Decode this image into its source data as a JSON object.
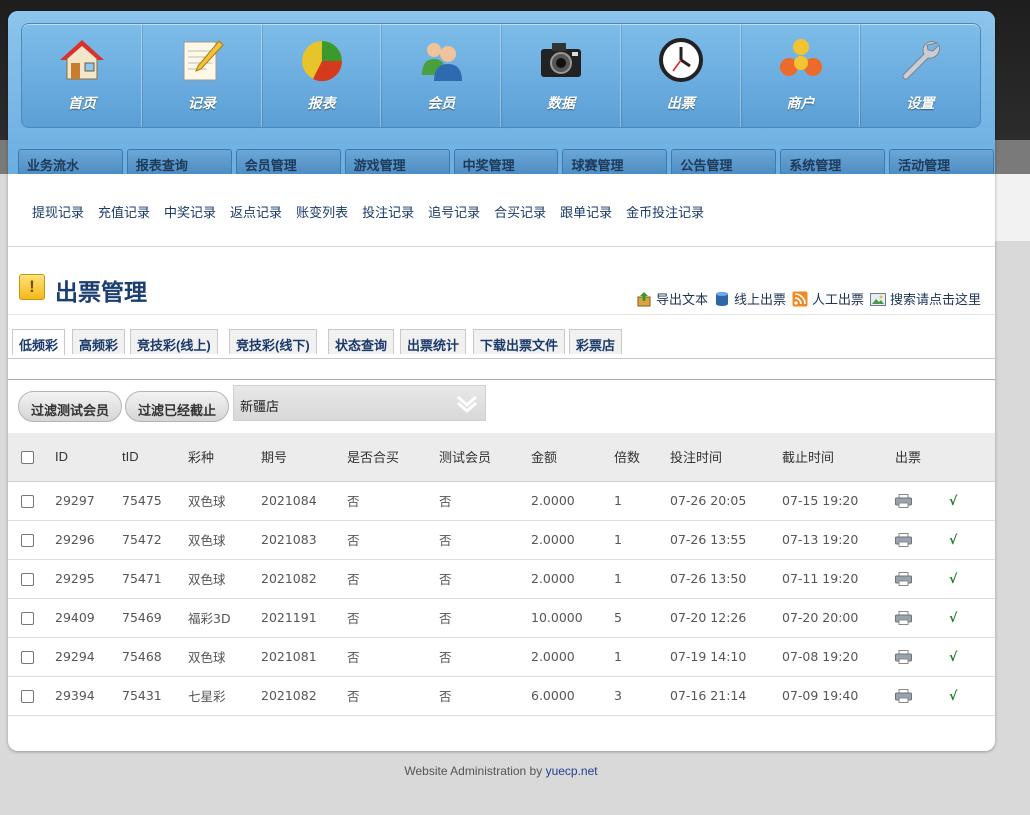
{
  "main_nav": [
    {
      "label": "首页",
      "icon": "home-icon"
    },
    {
      "label": "记录",
      "icon": "notepad-icon"
    },
    {
      "label": "报表",
      "icon": "pie-chart-icon"
    },
    {
      "label": "会员",
      "icon": "users-icon"
    },
    {
      "label": "数据",
      "icon": "camera-icon"
    },
    {
      "label": "出票",
      "icon": "clock-icon"
    },
    {
      "label": "商户",
      "icon": "merchant-icon"
    },
    {
      "label": "设置",
      "icon": "wrench-icon"
    }
  ],
  "sub_tabs": [
    "业务流水",
    "报表查询",
    "会员管理",
    "游戏管理",
    "中奖管理",
    "球赛管理",
    "公告管理",
    "系统管理",
    "活动管理"
  ],
  "sub_links": [
    "提现记录",
    "充值记录",
    "中奖记录",
    "返点记录",
    "账变列表",
    "投注记录",
    "追号记录",
    "合买记录",
    "跟单记录",
    "金币投注记录"
  ],
  "page": {
    "title": "出票管理",
    "title_icon": "!"
  },
  "actions": [
    {
      "label": "导出文本",
      "icon": "export-icon"
    },
    {
      "label": "线上出票",
      "icon": "database-icon"
    },
    {
      "label": "人工出票",
      "icon": "rss-icon"
    },
    {
      "label": "搜索请点击这里",
      "icon": "search-image-icon"
    }
  ],
  "lottery_tabs": [
    "低频彩",
    "高频彩",
    "竞技彩(线上)",
    "竞技彩(线下)",
    "状态查询",
    "出票统计",
    "下载出票文件",
    "彩票店"
  ],
  "filters": {
    "btn_test": "过滤测试会员",
    "btn_expired": "过滤已经截止",
    "store_selected": "新疆店"
  },
  "table": {
    "headers": [
      "ID",
      "tID",
      "彩种",
      "期号",
      "是否合买",
      "测试会员",
      "金额",
      "倍数",
      "投注时间",
      "截止时间",
      "出票"
    ],
    "rows": [
      {
        "id": "29297",
        "tid": "75475",
        "type": "双色球",
        "issue": "2021084",
        "joint": "否",
        "test": "否",
        "amount": "2.0000",
        "mult": "1",
        "bet_time": "07-26 20:05",
        "deadline": "07-15 19:20",
        "done": "√"
      },
      {
        "id": "29296",
        "tid": "75472",
        "type": "双色球",
        "issue": "2021083",
        "joint": "否",
        "test": "否",
        "amount": "2.0000",
        "mult": "1",
        "bet_time": "07-26 13:55",
        "deadline": "07-13 19:20",
        "done": "√"
      },
      {
        "id": "29295",
        "tid": "75471",
        "type": "双色球",
        "issue": "2021082",
        "joint": "否",
        "test": "否",
        "amount": "2.0000",
        "mult": "1",
        "bet_time": "07-26 13:50",
        "deadline": "07-11 19:20",
        "done": "√"
      },
      {
        "id": "29409",
        "tid": "75469",
        "type": "福彩3D",
        "issue": "2021191",
        "joint": "否",
        "test": "否",
        "amount": "10.0000",
        "mult": "5",
        "bet_time": "07-20 12:26",
        "deadline": "07-20 20:00",
        "done": "√"
      },
      {
        "id": "29294",
        "tid": "75468",
        "type": "双色球",
        "issue": "2021081",
        "joint": "否",
        "test": "否",
        "amount": "2.0000",
        "mult": "1",
        "bet_time": "07-19 14:10",
        "deadline": "07-08 19:20",
        "done": "√"
      },
      {
        "id": "29394",
        "tid": "75431",
        "type": "七星彩",
        "issue": "2021082",
        "joint": "否",
        "test": "否",
        "amount": "6.0000",
        "mult": "3",
        "bet_time": "07-16 21:14",
        "deadline": "07-09 19:40",
        "done": "√"
      }
    ]
  },
  "footer": {
    "text": "Website Administration by ",
    "link": "yuecp.net"
  },
  "colors": {
    "nav_blue": "#5b9fd6",
    "title_blue": "#1b3e70",
    "link_blue": "#1b3a6b",
    "green": "#1a7a1a"
  }
}
